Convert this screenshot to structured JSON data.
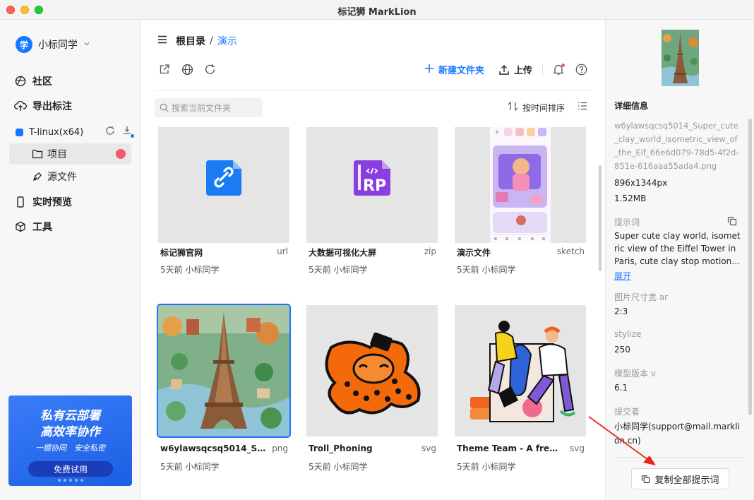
{
  "window": {
    "title": "标记狮 MarkLion"
  },
  "sidebar": {
    "user": {
      "avatar_text": "学",
      "name": "小标同学"
    },
    "nav": [
      {
        "label": "社区",
        "icon": "globe-icon"
      },
      {
        "label": "导出标注",
        "icon": "cloud-upload-icon"
      }
    ],
    "team": {
      "name": "T-linux(x64)"
    },
    "team_items": [
      {
        "label": "项目",
        "icon": "folder-icon"
      },
      {
        "label": "源文件",
        "icon": "pen-nib-icon"
      }
    ],
    "nav_bottom": [
      {
        "label": "实时预览",
        "icon": "phone-icon"
      },
      {
        "label": "工具",
        "icon": "cube-icon"
      }
    ],
    "promo": {
      "line1": "私有云部署",
      "line2": "高效率协作",
      "line3": "一键协同　安全私密",
      "button": "免费试用"
    }
  },
  "main": {
    "breadcrumb": {
      "root": "根目录",
      "separator": "/",
      "current": "演示"
    },
    "toolbar": {
      "new_folder": "新建文件夹",
      "upload": "上传"
    },
    "search": {
      "placeholder": "搜索当前文件夹"
    },
    "sort": {
      "label": "按时间排序"
    },
    "files": [
      {
        "name": "标记狮官网",
        "ext": "url",
        "meta": "5天前 小标同学"
      },
      {
        "name": "大数据可视化大屏",
        "ext": "zip",
        "meta": "5天前 小标同学",
        "icon_text": "RP"
      },
      {
        "name": "演示文件",
        "ext": "sketch",
        "meta": "5天前 小标同学"
      },
      {
        "name": "w6ylawsqcsq5014_Super_cute_clay_world",
        "ext": "png",
        "meta": "5天前 小标同学"
      },
      {
        "name": "Troll_Phoning",
        "ext": "svg",
        "meta": "5天前 小标同学"
      },
      {
        "name": "Theme Team - A free Theme",
        "ext": "svg",
        "meta": "5天前 小标同学"
      }
    ]
  },
  "panel": {
    "heading": "详细信息",
    "filename": "w6ylawsqcsq5014_Super_cute_clay_world_isometric_view_of_the_Eif_66e6d079-78d5-4f2d-851e-616aaa55ada4.png",
    "dimensions": "896x1344px",
    "size": "1.52MB",
    "prompt_label": "提示词",
    "prompt": "Super cute clay world, isometric view of the Eiffel Tower in Paris, cute clay stop motion animation",
    "expand": "展开",
    "fields": [
      {
        "label": "图片尺寸宽 ar",
        "value": "2:3"
      },
      {
        "label": "stylize",
        "value": "250"
      },
      {
        "label": "模型版本 v",
        "value": "6.1"
      }
    ],
    "submitter_label": "提交者",
    "submitter": "小标同学(support@mail.marklion.cn)",
    "copy_button": "复制全部提示词"
  },
  "colors": {
    "accent": "#1677ff",
    "badge": "#f5576c",
    "annotation": "#e8261c"
  }
}
